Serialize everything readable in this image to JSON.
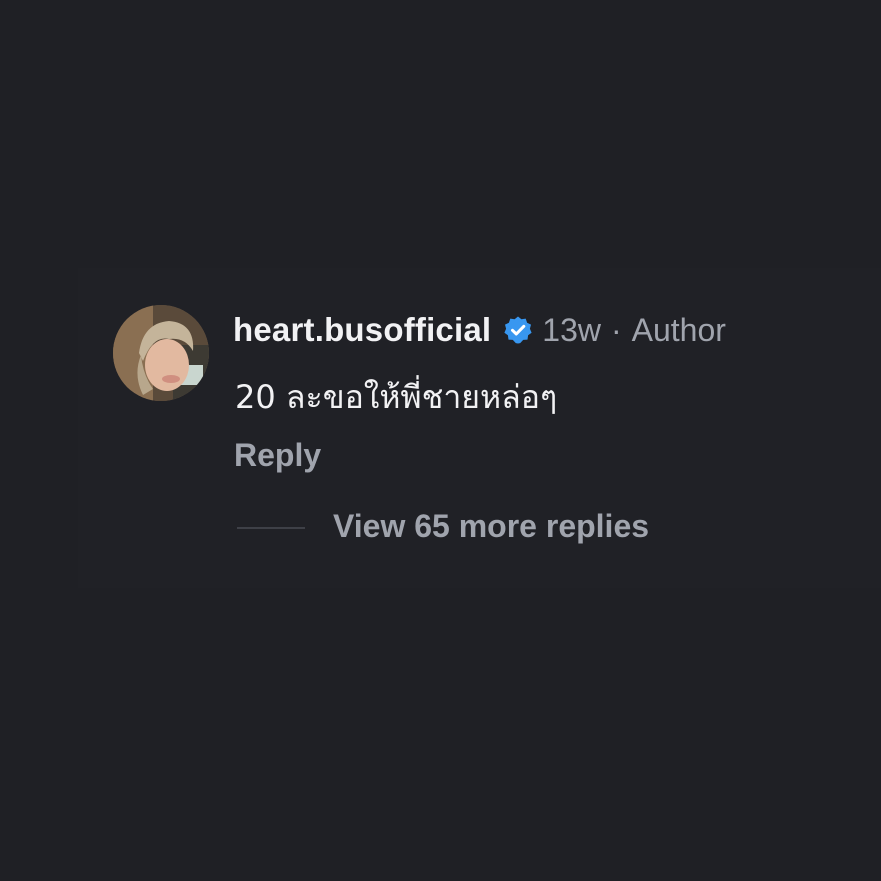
{
  "comment": {
    "username": "heart.busofficial",
    "verified_icon": "verified-badge-icon",
    "verified_color": "#3897f0",
    "time": "13w",
    "separator": "·",
    "role": "Author",
    "text": "20 ละขอให้พี่ชายหล่อๆ",
    "reply_label": "Reply",
    "view_replies_label": "View 65 more replies"
  },
  "colors": {
    "background": "#1f2025",
    "primary_text": "#f2f2f4",
    "secondary_text": "#a0a4ad"
  }
}
